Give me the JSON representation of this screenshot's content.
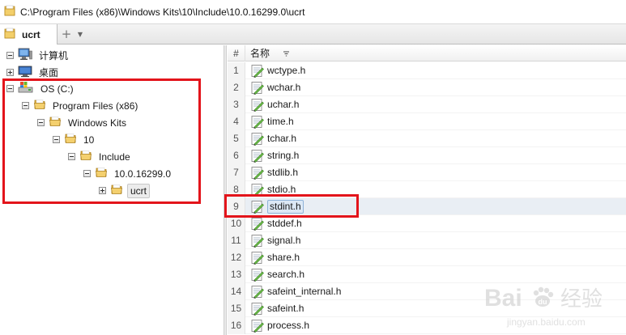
{
  "addressbar": {
    "path": "C:\\Program Files (x86)\\Windows Kits\\10\\Include\\10.0.16299.0\\ucrt"
  },
  "tabs": [
    {
      "label": "ucrt",
      "icon": "folder-icon",
      "active": true
    }
  ],
  "tabbar": {
    "add_label": "+",
    "menu_label": "▼"
  },
  "tree": {
    "nodes": [
      {
        "label": "计算机",
        "icon": "computer-icon",
        "expander": "minus",
        "depth": 0
      },
      {
        "label": "桌面",
        "icon": "desktop-icon",
        "expander": "plus",
        "depth": 0
      },
      {
        "label": "OS (C:)",
        "icon": "drive-icon",
        "expander": "minus",
        "depth": 0
      },
      {
        "label": "Program Files (x86)",
        "icon": "folder-icon",
        "expander": "minus",
        "depth": 1
      },
      {
        "label": "Windows Kits",
        "icon": "folder-icon",
        "expander": "minus",
        "depth": 2
      },
      {
        "label": "10",
        "icon": "folder-icon",
        "expander": "minus",
        "depth": 3
      },
      {
        "label": "Include",
        "icon": "folder-icon",
        "expander": "minus",
        "depth": 4
      },
      {
        "label": "10.0.16299.0",
        "icon": "folder-icon",
        "expander": "minus",
        "depth": 5
      },
      {
        "label": "ucrt",
        "icon": "folder-icon",
        "expander": "plus",
        "depth": 6,
        "selected": true
      }
    ]
  },
  "filelist": {
    "columns": {
      "number": "#",
      "name": "名称",
      "sort_icon": "filter-icon"
    },
    "rows": [
      {
        "num": "1",
        "name": "wctype.h"
      },
      {
        "num": "2",
        "name": "wchar.h"
      },
      {
        "num": "3",
        "name": "uchar.h"
      },
      {
        "num": "4",
        "name": "time.h"
      },
      {
        "num": "5",
        "name": "tchar.h"
      },
      {
        "num": "6",
        "name": "string.h"
      },
      {
        "num": "7",
        "name": "stdlib.h"
      },
      {
        "num": "8",
        "name": "stdio.h"
      },
      {
        "num": "9",
        "name": "stdint.h",
        "selected": true
      },
      {
        "num": "10",
        "name": "stddef.h"
      },
      {
        "num": "11",
        "name": "signal.h"
      },
      {
        "num": "12",
        "name": "share.h"
      },
      {
        "num": "13",
        "name": "search.h"
      },
      {
        "num": "14",
        "name": "safeint_internal.h"
      },
      {
        "num": "15",
        "name": "safeint.h"
      },
      {
        "num": "16",
        "name": "process.h"
      }
    ]
  },
  "colors": {
    "highlight": "#e3141b",
    "folder": "#e9c25a",
    "selection": "#dce8f5"
  },
  "watermark": {
    "brand": "Bai",
    "brand_glyph": "du",
    "suffix": "经验",
    "url": "jingyan.baidu.com"
  }
}
